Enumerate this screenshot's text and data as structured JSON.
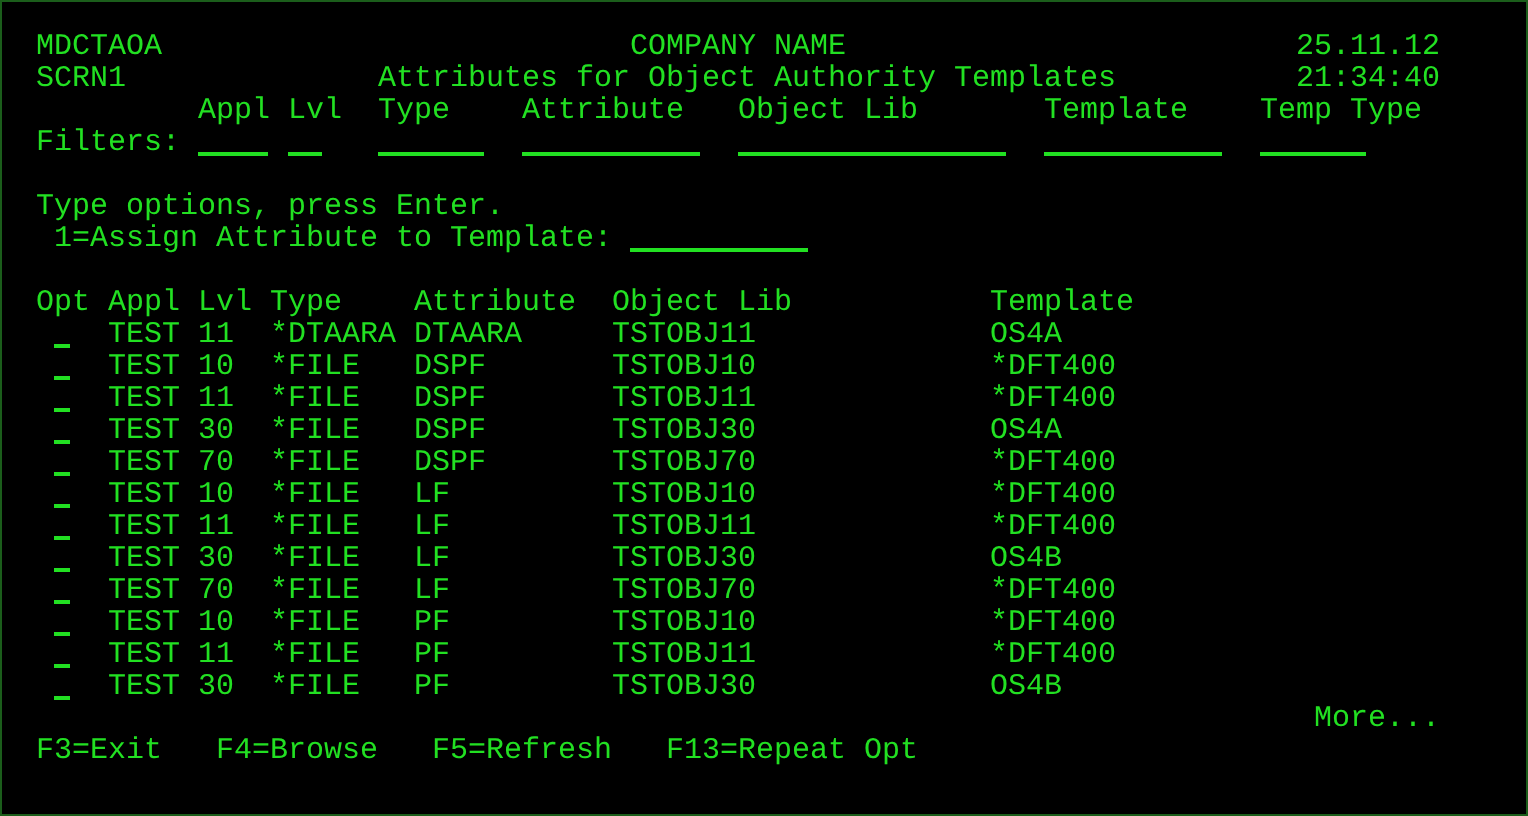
{
  "header": {
    "program": "MDCTAOA",
    "company": "COMPANY NAME",
    "date": "25.11.12",
    "screen_id": "SCRN1",
    "title": "Attributes for Object Authority Templates",
    "time": "21:34:40"
  },
  "filters": {
    "label": "Filters:",
    "columns": [
      {
        "label": "Appl"
      },
      {
        "label": "Lvl"
      },
      {
        "label": "Type"
      },
      {
        "label": "Attribute"
      },
      {
        "label": "Object Lib"
      },
      {
        "label": "Template"
      },
      {
        "label": "Temp Type"
      }
    ]
  },
  "instructions": {
    "prompt": "Type options, press Enter.",
    "option": "1=Assign Attribute to Template:"
  },
  "table": {
    "columns": [
      "Opt",
      "Appl",
      "Lvl",
      "Type",
      "Attribute",
      "Object Lib",
      "Template"
    ],
    "rows": [
      {
        "appl": "TEST",
        "lvl": "11",
        "type": "*DTAARA",
        "attribute": "DTAARA",
        "object_lib": "TSTOBJ11",
        "template": "OS4A"
      },
      {
        "appl": "TEST",
        "lvl": "10",
        "type": "*FILE",
        "attribute": "DSPF",
        "object_lib": "TSTOBJ10",
        "template": "*DFT400"
      },
      {
        "appl": "TEST",
        "lvl": "11",
        "type": "*FILE",
        "attribute": "DSPF",
        "object_lib": "TSTOBJ11",
        "template": "*DFT400"
      },
      {
        "appl": "TEST",
        "lvl": "30",
        "type": "*FILE",
        "attribute": "DSPF",
        "object_lib": "TSTOBJ30",
        "template": "OS4A"
      },
      {
        "appl": "TEST",
        "lvl": "70",
        "type": "*FILE",
        "attribute": "DSPF",
        "object_lib": "TSTOBJ70",
        "template": "*DFT400"
      },
      {
        "appl": "TEST",
        "lvl": "10",
        "type": "*FILE",
        "attribute": "LF",
        "object_lib": "TSTOBJ10",
        "template": "*DFT400"
      },
      {
        "appl": "TEST",
        "lvl": "11",
        "type": "*FILE",
        "attribute": "LF",
        "object_lib": "TSTOBJ11",
        "template": "*DFT400"
      },
      {
        "appl": "TEST",
        "lvl": "30",
        "type": "*FILE",
        "attribute": "LF",
        "object_lib": "TSTOBJ30",
        "template": "OS4B"
      },
      {
        "appl": "TEST",
        "lvl": "70",
        "type": "*FILE",
        "attribute": "LF",
        "object_lib": "TSTOBJ70",
        "template": "*DFT400"
      },
      {
        "appl": "TEST",
        "lvl": "10",
        "type": "*FILE",
        "attribute": "PF",
        "object_lib": "TSTOBJ10",
        "template": "*DFT400"
      },
      {
        "appl": "TEST",
        "lvl": "11",
        "type": "*FILE",
        "attribute": "PF",
        "object_lib": "TSTOBJ11",
        "template": "*DFT400"
      },
      {
        "appl": "TEST",
        "lvl": "30",
        "type": "*FILE",
        "attribute": "PF",
        "object_lib": "TSTOBJ30",
        "template": "OS4B"
      }
    ]
  },
  "more": "More...",
  "function_keys": [
    "F3=Exit",
    "F4=Browse",
    "F5=Refresh",
    "F13=Repeat Opt"
  ]
}
